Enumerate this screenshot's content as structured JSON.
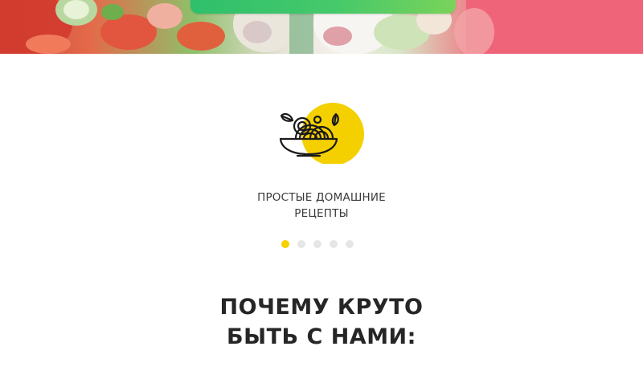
{
  "hero": {
    "image_name": "salad-banner-image",
    "cta_button_label": ""
  },
  "feature_slider": {
    "icon": "noodle-bowl-icon",
    "accent_color": "#f5d000",
    "label_line1": "ПРОСТЫЕ ДОМАШНИЕ",
    "label_line2": "РЕЦЕПТЫ",
    "slides_total": 5,
    "active_slide": 1
  },
  "why_section": {
    "heading_line1": "ПОЧЕМУ КРУТО",
    "heading_line2": "БЫТЬ С НАМИ:"
  }
}
